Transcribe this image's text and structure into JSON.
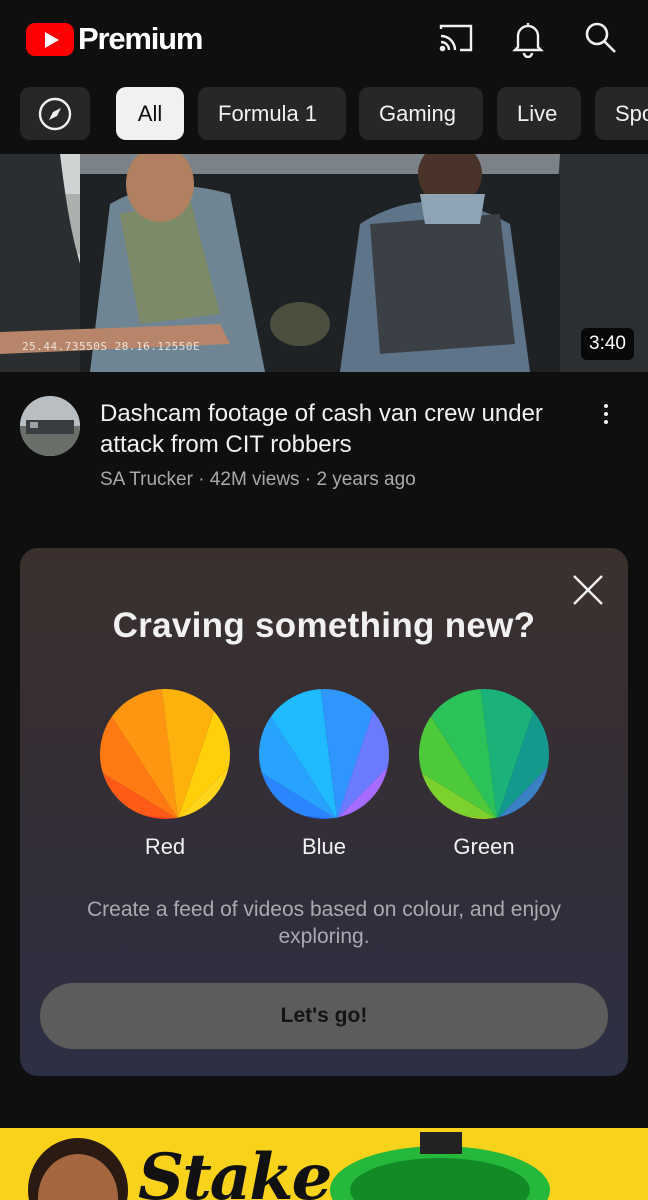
{
  "app": {
    "brand": "Premium"
  },
  "header": {
    "icons": [
      "cast-icon",
      "notifications-icon",
      "search-icon"
    ]
  },
  "chips": [
    {
      "label": "All",
      "active": true
    },
    {
      "label": "Formula 1",
      "active": false
    },
    {
      "label": "Gaming",
      "active": false
    },
    {
      "label": "Live",
      "active": false
    },
    {
      "label": "Spo",
      "active": false
    }
  ],
  "video": {
    "title": "Dashcam footage of cash van crew under attack from CIT robbers",
    "channel_line": "SA Trucker · 42M views · 2 years ago",
    "duration": "3:40",
    "overlay_text": "25.44.73550S 28.16.12550E"
  },
  "promo": {
    "title": "Craving something new?",
    "swatches": [
      {
        "label": "Red",
        "colors": [
          "#ff3b1f",
          "#ff5a17",
          "#ff7a12",
          "#ff9510",
          "#ffb20d",
          "#ffcf0a",
          "#ffd41a"
        ]
      },
      {
        "label": "Blue",
        "colors": [
          "#1f6bff",
          "#2a86ff",
          "#28a2ff",
          "#1fbaff",
          "#2f95ff",
          "#6a7bff",
          "#a66bff"
        ]
      },
      {
        "label": "Green",
        "colors": [
          "#a7d92a",
          "#7dd12e",
          "#4ec93a",
          "#2cc25a",
          "#1bb27a",
          "#139a8c",
          "#3b7fc4"
        ]
      }
    ],
    "description": "Create a feed of videos based on colour, and enjoy exploring.",
    "cta": "Let's go!"
  },
  "ad": {
    "text": "Stake"
  }
}
